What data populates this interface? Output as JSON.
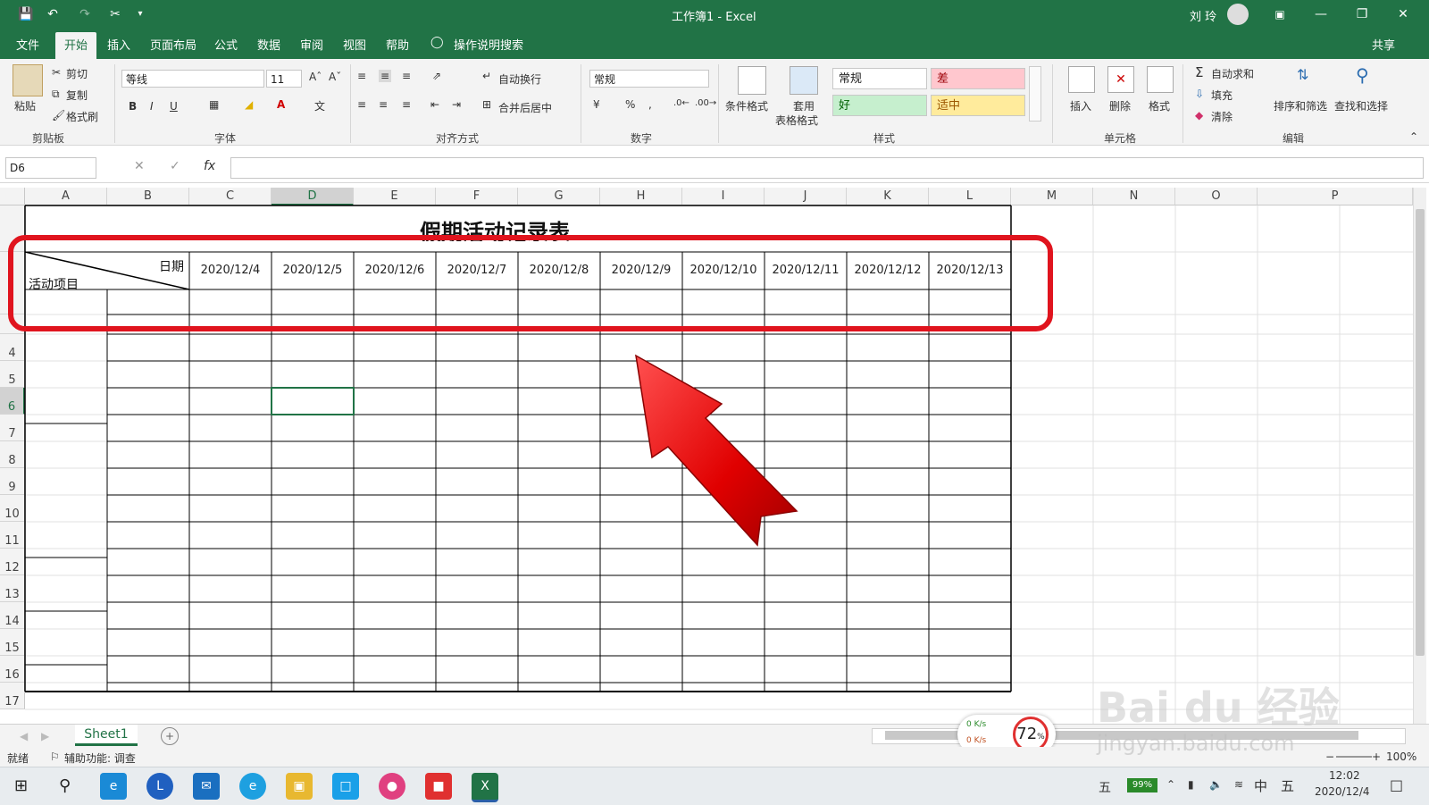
{
  "window": {
    "title": "工作簿1  -  Excel",
    "user": "刘 玲"
  },
  "tabs": [
    "文件",
    "开始",
    "插入",
    "页面布局",
    "公式",
    "数据",
    "审阅",
    "视图",
    "帮助"
  ],
  "tell_me": "操作说明搜索",
  "share": "共享",
  "ribbon": {
    "clipboard": {
      "paste": "粘贴",
      "cut": "剪切",
      "copy": "复制",
      "format_painter": "格式刷",
      "group": "剪贴板"
    },
    "font": {
      "name": "等线",
      "size": "11",
      "group": "字体"
    },
    "alignment": {
      "wrap": "自动换行",
      "merge": "合并后居中",
      "group": "对齐方式"
    },
    "number": {
      "format": "常规",
      "group": "数字"
    },
    "styles": {
      "conditional": "条件格式",
      "table_format_1": "套用",
      "table_format_2": "表格格式",
      "normal": "常规",
      "bad": "差",
      "good": "好",
      "neutral": "适中",
      "group": "样式"
    },
    "cells": {
      "insert": "插入",
      "delete": "删除",
      "format": "格式",
      "group": "单元格"
    },
    "editing": {
      "autosum": "自动求和",
      "fill": "填充",
      "clear": "清除",
      "sort": "排序和筛选",
      "find": "查找和选择",
      "group": "编辑"
    }
  },
  "formula_bar": {
    "name_box": "D6",
    "fx": "fx",
    "value": ""
  },
  "columns": [
    "A",
    "B",
    "C",
    "D",
    "E",
    "F",
    "G",
    "H",
    "I",
    "J",
    "K",
    "L",
    "M",
    "N",
    "O",
    "P"
  ],
  "rows": [
    "4",
    "5",
    "6",
    "7",
    "8",
    "9",
    "10",
    "11",
    "12",
    "13",
    "14",
    "15",
    "16",
    "17"
  ],
  "sheet": {
    "title": "假期活动记录表",
    "corner_top": "日期",
    "corner_bottom": "活动项目",
    "dates": [
      "2020/12/4",
      "2020/12/5",
      "2020/12/6",
      "2020/12/7",
      "2020/12/8",
      "2020/12/9",
      "2020/12/10",
      "2020/12/11",
      "2020/12/12",
      "2020/12/13"
    ]
  },
  "sheet_tabs": [
    "Sheet1"
  ],
  "status": {
    "ready": "就绪",
    "accessibility": "辅助功能: 调查",
    "zoom": "100%"
  },
  "overlay": {
    "net_up": "0  K/s",
    "net_down": "0  K/s",
    "cpu": "72",
    "cpu_unit": "%"
  },
  "watermark": {
    "brand": "Bai du 经验",
    "url": "jingyan.baidu.com"
  },
  "taskbar": {
    "ime": "五",
    "battery": "99%",
    "lang": "中",
    "ime2": "五",
    "time": "12:02",
    "date": "2020/12/4"
  },
  "colors": {
    "excel_green": "#217346",
    "highlight_red": "#e0141e"
  }
}
